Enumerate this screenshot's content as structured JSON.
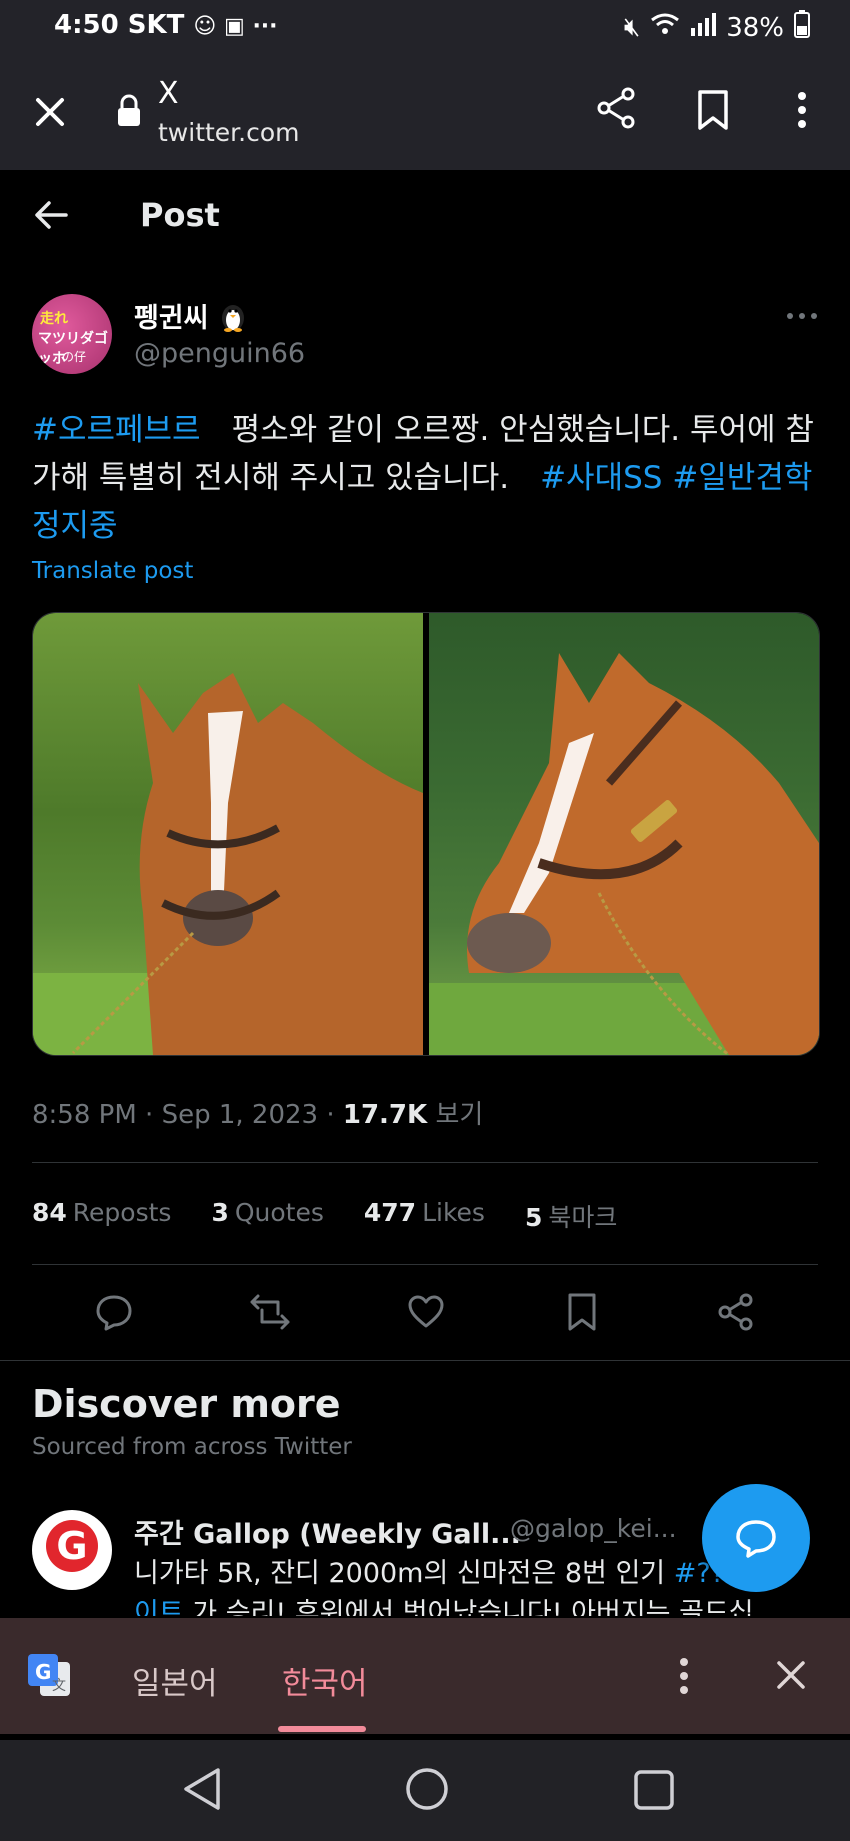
{
  "status_bar": {
    "time": "4:50",
    "carrier": "SKT",
    "battery": "38%"
  },
  "browser": {
    "page_title": "X",
    "url": "twitter.com"
  },
  "header": {
    "title": "Post"
  },
  "post": {
    "display_name": "펭귄씨",
    "handle": "@penguin66",
    "avatar_text": [
      "走れ",
      "マツリダゴッホ",
      "の仔"
    ],
    "text_segments": [
      {
        "text": "#오르페브르",
        "hashtag": true
      },
      {
        "text": "　평소와 같이 오르짱. 안심했습니다. 투어에 참가해 특별히 전시해 주시고 있습니다.　",
        "hashtag": false
      },
      {
        "text": "#사대SS",
        "hashtag": true
      },
      {
        "text": " ",
        "hashtag": false
      },
      {
        "text": "#일반견학정지중",
        "hashtag": true
      }
    ],
    "translate_label": "Translate post",
    "time": "8:58 PM",
    "date": "Sep 1, 2023",
    "views_count": "17.7K",
    "views_label": "보기",
    "stats": {
      "reposts_count": "84",
      "reposts_label": "Reposts",
      "quotes_count": "3",
      "quotes_label": "Quotes",
      "likes_count": "477",
      "likes_label": "Likes",
      "bookmarks_count": "5",
      "bookmarks_label": "북마크"
    },
    "action_icons": [
      "reply-icon",
      "repost-icon",
      "like-icon",
      "bookmark-icon",
      "share-icon"
    ]
  },
  "discover": {
    "title": "Discover more",
    "subtitle": "Sourced from across Twitter",
    "item": {
      "name": "주간 Gallop (Weekly Gall...",
      "handle": "@galop_kei...",
      "text_plain": "니가타 5R, 잔디 2000m의 신마전은 8번 인기 ",
      "text_hashtag": "#??",
      "text_line2_hashtag": "이트",
      "text_line2_rest": " 가 승리! 후위에서 벗어났습니다! 아버지는 골드십,"
    }
  },
  "translate_bar": {
    "lang_source": "일본어",
    "lang_target": "한국어"
  },
  "colors": {
    "accent": "#1d9bf0",
    "muted": "#71767b",
    "translate_active": "#f28b9a"
  }
}
